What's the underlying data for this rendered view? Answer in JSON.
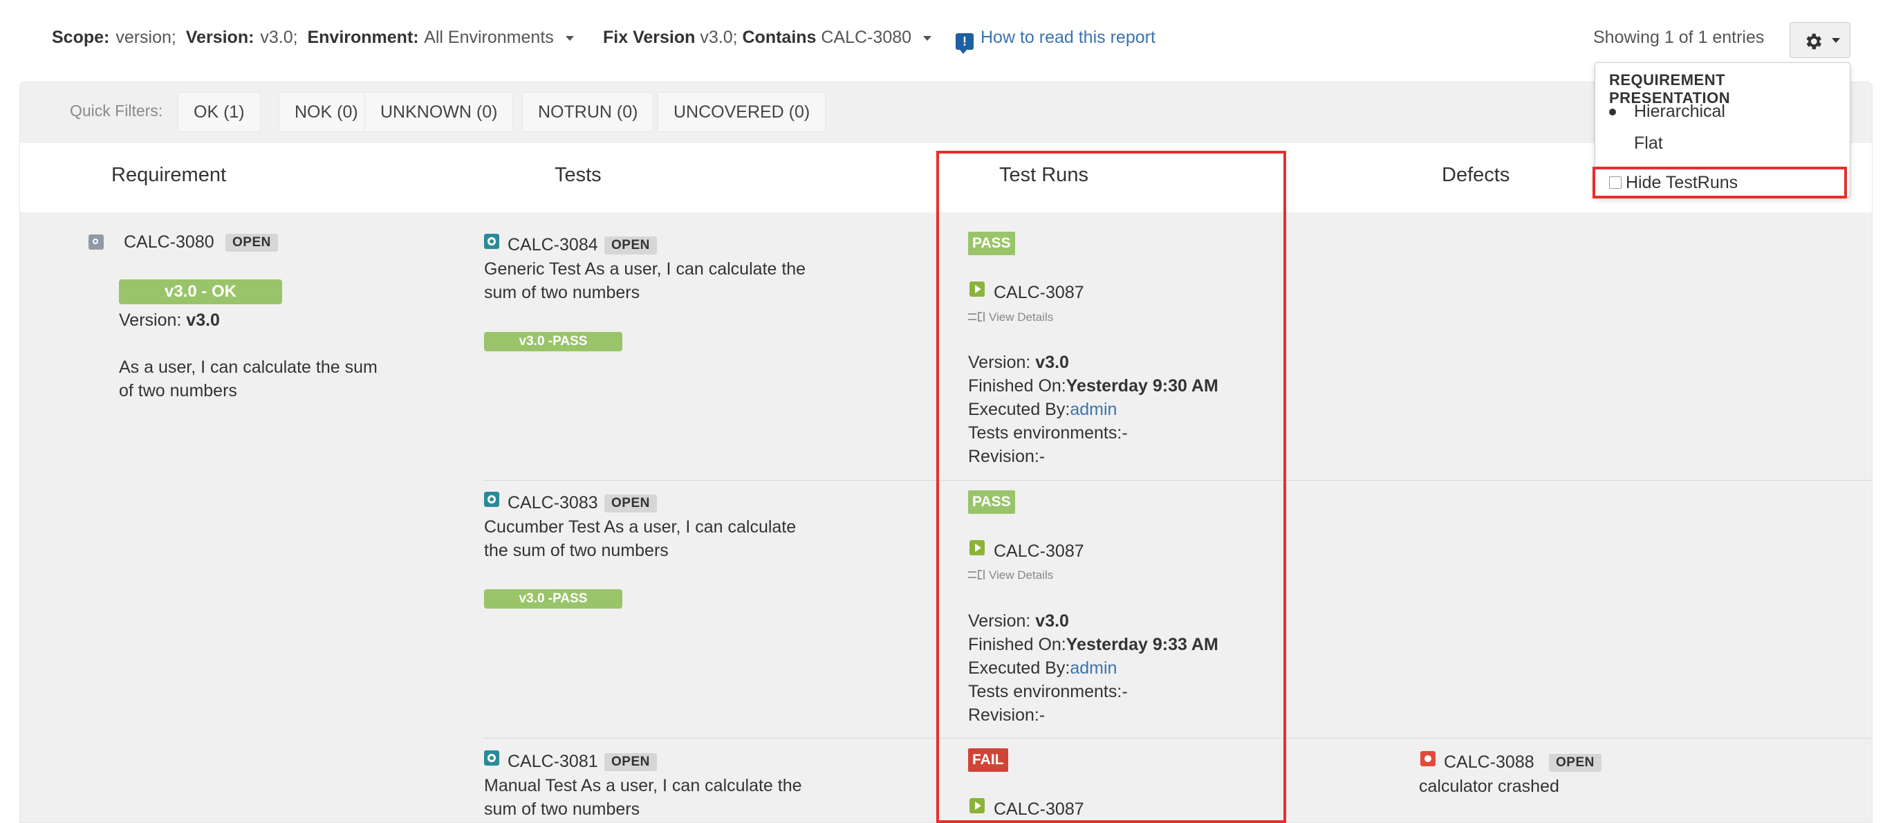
{
  "header": {
    "scope_label": "Scope:",
    "scope_value": "version;",
    "version_label": "Version:",
    "version_value": "v3.0;",
    "environment_label": "Environment:",
    "environment_value": "All Environments",
    "fix_version_label": "Fix Version",
    "fix_version_value": "v3.0;",
    "contains_label": "Contains",
    "contains_value": "CALC-3080",
    "how_to_read": "How to read this report",
    "showing": "Showing 1 of 1 entries"
  },
  "dropdown": {
    "header": "REQUIREMENT PRESENTATION",
    "options": [
      "Hierarchical",
      "Flat"
    ],
    "selected": "Hierarchical",
    "hide_testruns_label": "Hide TestRuns"
  },
  "quick_filters": {
    "label": "Quick Filters:",
    "items": [
      "OK (1)",
      "NOK (0)",
      "UNKNOWN (0)",
      "NOTRUN (0)",
      "UNCOVERED (0)"
    ]
  },
  "columns": [
    "Requirement",
    "Tests",
    "Test Runs",
    "Defects"
  ],
  "requirement": {
    "key": "CALC-3080",
    "status": "OPEN",
    "coverage": "v3.0 - OK",
    "version_label": "Version:",
    "version_value": "v3.0",
    "summary_line1": "As a user, I can calculate the sum",
    "summary_line2": "of two numbers"
  },
  "tests": [
    {
      "key": "CALC-3084",
      "status": "OPEN",
      "line1": "Generic Test As a user, I can calculate the",
      "line2": "sum of two numbers",
      "badge": "v3.0 -PASS"
    },
    {
      "key": "CALC-3083",
      "status": "OPEN",
      "line1": "Cucumber Test As a user, I can calculate",
      "line2": "the sum of two numbers",
      "badge": "v3.0 -PASS"
    },
    {
      "key": "CALC-3081",
      "status": "OPEN",
      "line1": "Manual Test As a user, I can calculate the",
      "line2": "sum of two numbers"
    }
  ],
  "runs": [
    {
      "result": "PASS",
      "key": "CALC-3087",
      "view_details": "View Details",
      "version_label": "Version:",
      "version_value": "v3.0",
      "finished_label": "Finished On:",
      "finished_value": "Yesterday 9:30 AM",
      "executed_label": "Executed By:",
      "executed_value": "admin",
      "env": "Tests environments:-",
      "revision": "Revision:-"
    },
    {
      "result": "PASS",
      "key": "CALC-3087",
      "view_details": "View Details",
      "version_label": "Version:",
      "version_value": "v3.0",
      "finished_label": "Finished On:",
      "finished_value": "Yesterday 9:33 AM",
      "executed_label": "Executed By:",
      "executed_value": "admin",
      "env": "Tests environments:-",
      "revision": "Revision:-"
    },
    {
      "result": "FAIL",
      "key": "CALC-3087"
    }
  ],
  "defect": {
    "key": "CALC-3088",
    "status": "OPEN",
    "summary": "calculator crashed"
  },
  "colors": {
    "link": "#3b73af",
    "pass": "#99c46a",
    "fail": "#d04437",
    "highlight": "#e5302d"
  }
}
